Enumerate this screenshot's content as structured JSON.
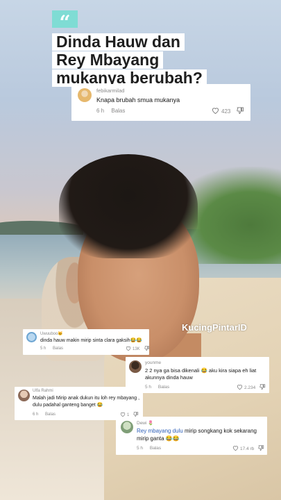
{
  "headline": {
    "quote_mark": "“",
    "lines": [
      "Dinda Hauw dan",
      "Rey Mbayang",
      "mukanya berubah?"
    ]
  },
  "watermark": "KucingPintarID",
  "comments": [
    {
      "user": "febikarmilad",
      "text": "Knapa brubah smua mukanya",
      "time": "6 h",
      "reply": "Balas",
      "likes": "423"
    },
    {
      "user": "Uwuuboo🐱",
      "text": "dinda hauw makin mirip sinta clara gaksih😂😂",
      "time": "5 h",
      "reply": "Balas",
      "likes": "13K"
    },
    {
      "user": "younme",
      "text": "2 2 nya ga bisa dikenali 😂 aku kira siapa eh liat akunnya dinda hauw",
      "time": "5 h",
      "reply": "Balas",
      "likes": "2.234"
    },
    {
      "user": "Ulfa Rahmi",
      "text": "Malah jadi Mirip anak dukun itu loh rey mbayang , dulu padahal ganteng banget 😂",
      "time": "6 h",
      "reply": "Balas",
      "likes": "1"
    },
    {
      "user": "Dewi 🌷",
      "mention": "Rey mbayang dulu",
      "text": " mirip songkang kok sekarang mirip ganta 😂😂",
      "time": "5 h",
      "reply": "Balas",
      "likes": "17.4 rb"
    }
  ],
  "icons": {
    "like": "heart-icon",
    "dislike": "thumbs-down-icon"
  },
  "colors": {
    "quote_accent": "#7fdcd4",
    "mention": "#2d5fb8"
  }
}
